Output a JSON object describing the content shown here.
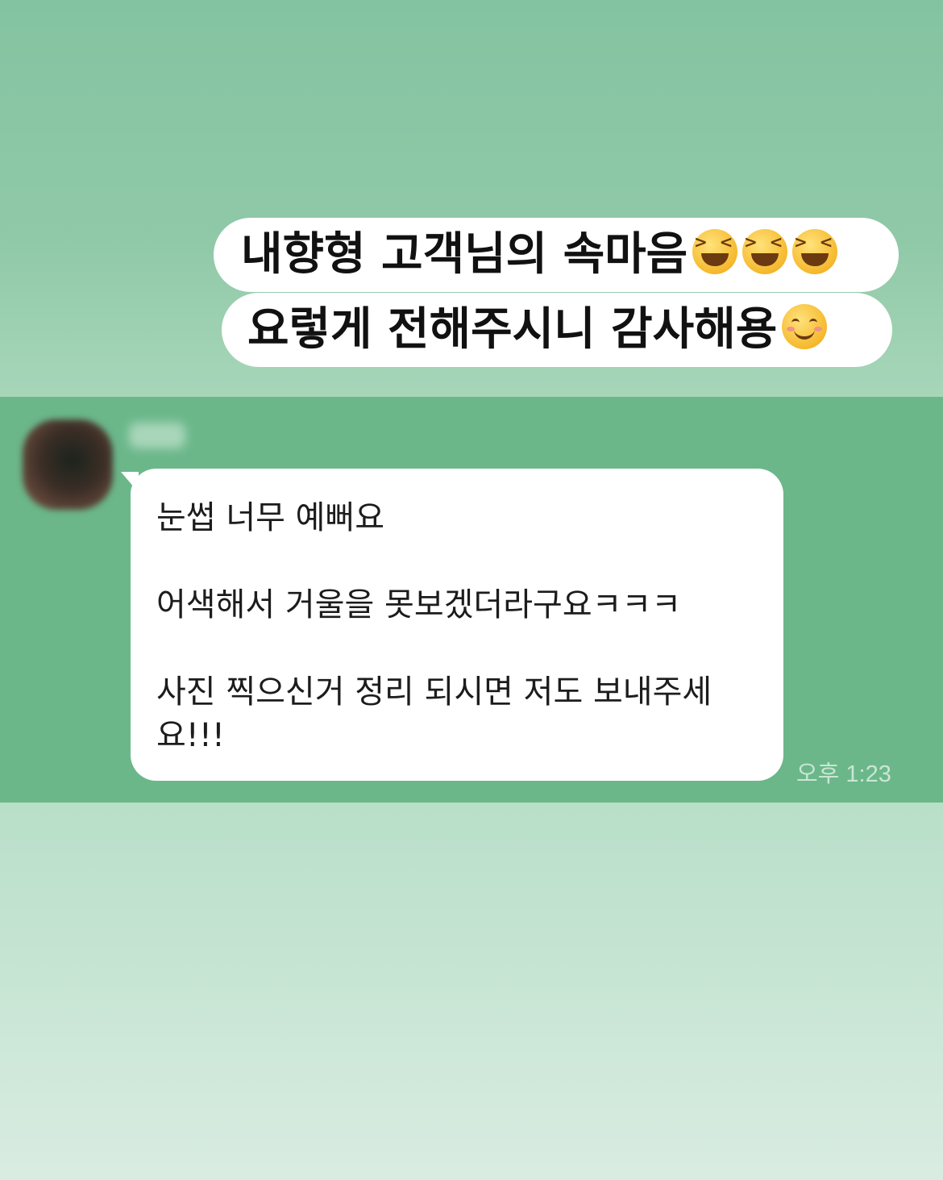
{
  "caption": {
    "line1": "내향형 고객님의 속마음",
    "line1_emojis": [
      "laughing-face",
      "laughing-face",
      "laughing-face"
    ],
    "line2": "요렇게 전해주시니 감사해용",
    "line2_emojis": [
      "smiling-face"
    ]
  },
  "chat": {
    "message_lines": [
      "눈썹 너무 예뻐요",
      "",
      "어색해서 거울을 못보겠더라구요ㅋㅋㅋ",
      "",
      "사진 찍으신거 정리 되시면 저도 보내주세",
      "요!!!"
    ],
    "timestamp": "오후 1:23"
  },
  "colors": {
    "top_background": "#84c3a1",
    "chat_background": "#6bb78a",
    "bottom_background": "#d9ece1",
    "bubble": "#ffffff",
    "caption_text": "#111111"
  }
}
